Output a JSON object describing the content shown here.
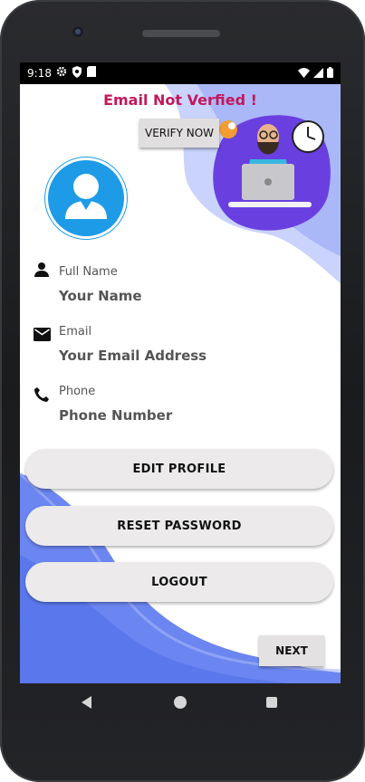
{
  "status_bar": {
    "time": "9:18",
    "icons_left": [
      "gear-icon",
      "shield-icon",
      "sim-card-icon"
    ],
    "icons_right": [
      "wifi-icon",
      "signal-icon",
      "battery-icon"
    ]
  },
  "header": {
    "warning": "Email Not Verfied !",
    "verify_button": "VERIFY NOW",
    "warning_color": "#c2185b"
  },
  "profile": {
    "avatar_icon": "user-avatar-icon",
    "fields": [
      {
        "icon": "person-icon",
        "label": "Full Name",
        "value": "Your Name"
      },
      {
        "icon": "mail-icon",
        "label": "Email",
        "value": "Your Email Address"
      },
      {
        "icon": "phone-icon",
        "label": "Phone",
        "value": "Phone Number"
      }
    ]
  },
  "actions": {
    "edit_profile": "EDIT PROFILE",
    "reset_password": "RESET PASSWORD",
    "logout": "LOGOUT",
    "next": "NEXT"
  },
  "colors": {
    "accent_blue": "#6b86f0",
    "avatar_blue": "#1e9be6",
    "button_bg": "#eceaea"
  },
  "nav": {
    "icons": [
      "back-icon",
      "home-icon",
      "recents-icon"
    ]
  }
}
